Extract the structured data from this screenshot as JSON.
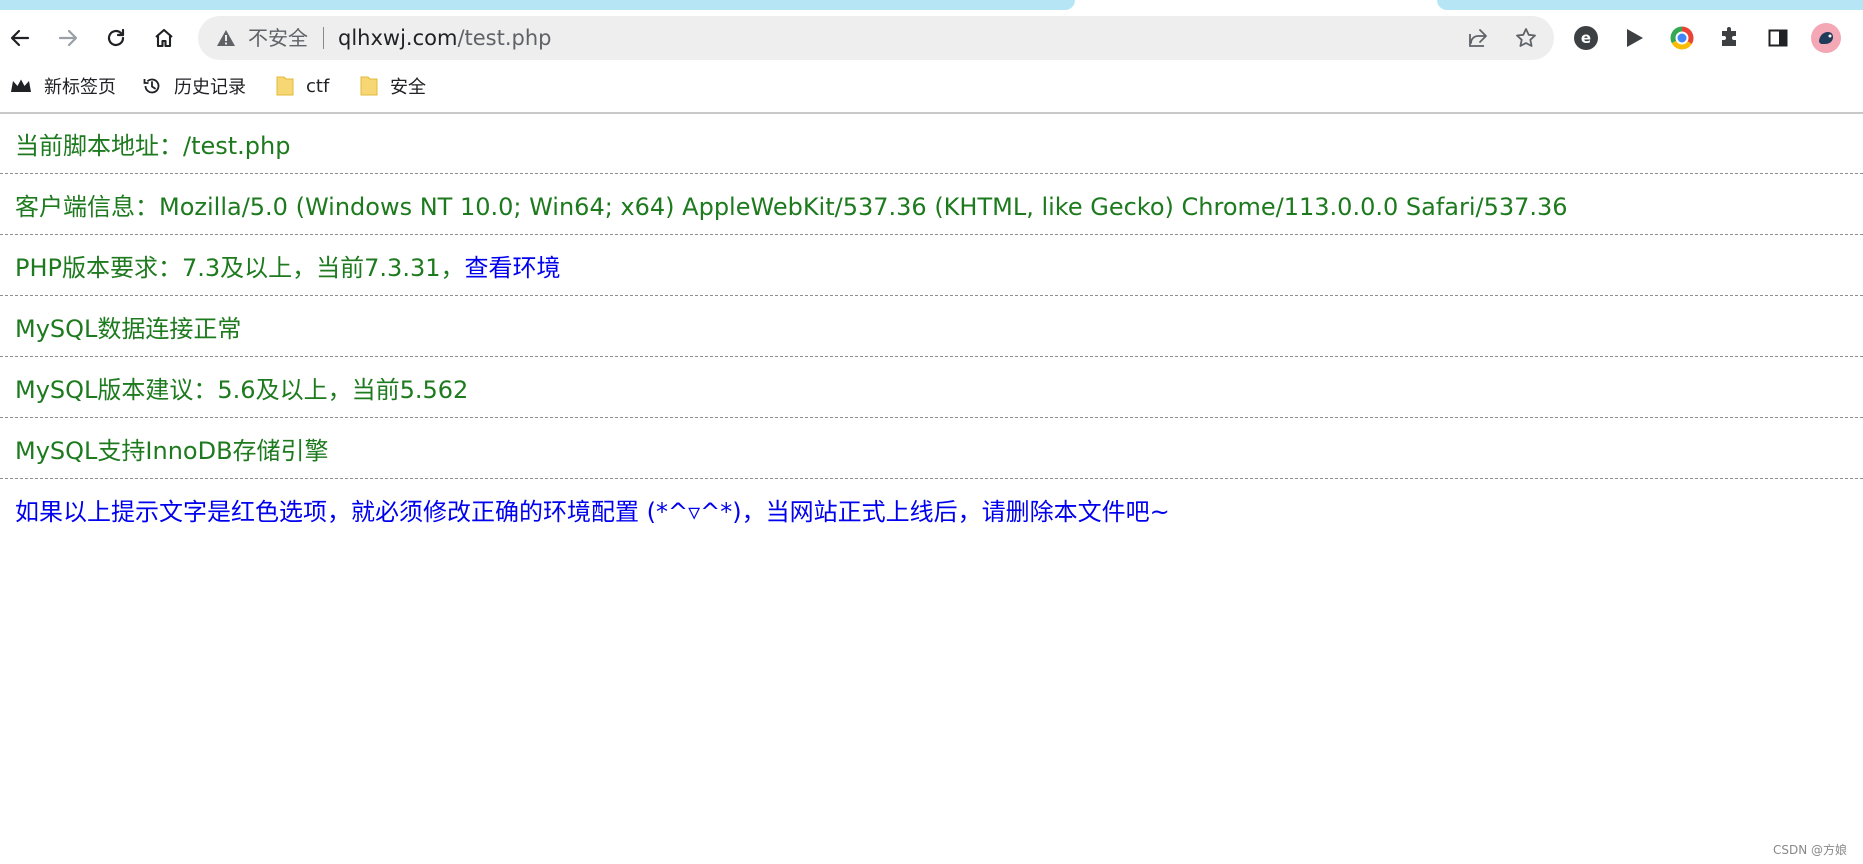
{
  "browser": {
    "nav": {
      "back_icon": "arrow-left-icon",
      "forward_icon": "arrow-right-icon",
      "reload_icon": "reload-icon",
      "home_icon": "home-icon"
    },
    "omnibox": {
      "security_label": "不安全",
      "url_host": "qlhxwj.com",
      "url_path": "/test.php"
    },
    "bookmarks": [
      {
        "label": "新标签页",
        "icon": "crown-icon"
      },
      {
        "label": "历史记录",
        "icon": "history-icon"
      },
      {
        "label": "ctf",
        "icon": "folder-icon"
      },
      {
        "label": "安全",
        "icon": "folder-icon"
      }
    ],
    "colors": {
      "tab_accent": "#b6e6f5",
      "omnibox_bg": "#eeeeee"
    }
  },
  "page": {
    "rows": [
      {
        "text": "当前脚本地址：/test.php"
      },
      {
        "text": "客户端信息：Mozilla/5.0 (Windows NT 10.0; Win64; x64) AppleWebKit/537.36 (KHTML, like Gecko) Chrome/113.0.0.0 Safari/537.36"
      },
      {
        "text": "PHP版本要求：7.3及以上，当前7.3.31，",
        "link": "查看环境"
      },
      {
        "text": "MySQL数据连接正常"
      },
      {
        "text": "MySQL版本建议：5.6及以上，当前5.562"
      },
      {
        "text": "MySQL支持InnoDB存储引擎"
      },
      {
        "text": "如果以上提示文字是红色选项，就必须修改正确的环境配置 (*^▿^*)，当网站正式上线后，请删除本文件吧~"
      }
    ],
    "colors": {
      "ok_text": "#1e7a1e",
      "link_text": "#0000ee"
    }
  },
  "watermark": "CSDN @方娘"
}
